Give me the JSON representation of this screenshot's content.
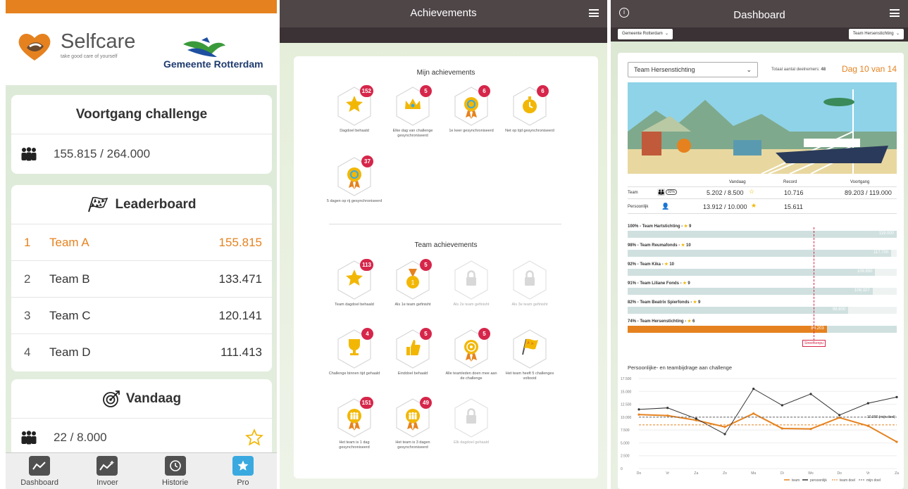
{
  "left": {
    "brand": {
      "name": "Selfcare",
      "tagline": "take good care of yourself",
      "partner": "Gemeente Rotterdam"
    },
    "progress": {
      "title": "Voortgang challenge",
      "value": "155.815 / 264.000",
      "icon": "people-icon"
    },
    "leaderboard": {
      "title": "Leaderboard",
      "icon": "checkered-flag-icon",
      "rows": [
        {
          "rank": "1",
          "team": "Team A",
          "value": "155.815"
        },
        {
          "rank": "2",
          "team": "Team B",
          "value": "133.471"
        },
        {
          "rank": "3",
          "team": "Team C",
          "value": "120.141"
        },
        {
          "rank": "4",
          "team": "Team D",
          "value": "111.413"
        }
      ]
    },
    "today": {
      "title": "Vandaag",
      "icon": "dart-target-icon",
      "value": "22 / 8.000"
    },
    "tabs": [
      {
        "label": "Dashboard",
        "icon": "chart-line-icon"
      },
      {
        "label": "Invoer",
        "icon": "chart-add-icon"
      },
      {
        "label": "Historie",
        "icon": "history-icon"
      },
      {
        "label": "Pro",
        "icon": "star-icon"
      }
    ]
  },
  "middle": {
    "title": "Achievements",
    "mine_title": "Mijn achievements",
    "mine": [
      {
        "label": "Dagdoel behaald",
        "count": "152",
        "icon": "star-icon"
      },
      {
        "label": "Elke dag van challenge gesynchroniseerd",
        "count": "5",
        "icon": "crown-icon"
      },
      {
        "label": "1e keer gesynchroniseerd",
        "count": "6",
        "icon": "sync-medal-icon"
      },
      {
        "label": "Net op tijd gesynchroniseerd",
        "count": "6",
        "icon": "stopwatch-icon"
      },
      {
        "label": "5 dagen op rij gesynchroniseerd",
        "count": "37",
        "icon": "sync-medal-icon"
      }
    ],
    "team_title": "Team achievements",
    "team": [
      {
        "label": "Team dagdoel behaald",
        "count": "113",
        "icon": "star-icon",
        "locked": false
      },
      {
        "label": "Als 1e team gefinisht",
        "count": "5",
        "icon": "medal-icon",
        "locked": false
      },
      {
        "label": "Als 2e team gefinisht",
        "count": "",
        "icon": "lock-icon",
        "locked": true
      },
      {
        "label": "Als 3e team gefinisht",
        "count": "",
        "icon": "lock-icon",
        "locked": true
      },
      {
        "label": "Challenge binnen tijd gehaald",
        "count": "4",
        "icon": "trophy-icon",
        "locked": false
      },
      {
        "label": "Einddoel behaald",
        "count": "5",
        "icon": "thumbs-up-icon",
        "locked": false
      },
      {
        "label": "Alle teamleden doen mee aan de challenge",
        "count": "5",
        "icon": "target-medal-icon",
        "locked": false
      },
      {
        "label": "Het team heeft 5 challenges voltooid",
        "count": "",
        "icon": "checkered-flag-icon",
        "locked": false
      },
      {
        "label": "Het team is 1 dag gesynchroniseerd",
        "count": "151",
        "icon": "team-medal-icon",
        "locked": false
      },
      {
        "label": "Het team is 3 dagen gesynchroniseerd",
        "count": "49",
        "icon": "team-medal-icon",
        "locked": false
      },
      {
        "label": "Elk dagdoel gehaald",
        "count": "",
        "icon": "lock-icon",
        "locked": true
      }
    ]
  },
  "right": {
    "title": "Dashboard",
    "org_select": "Gemeente Rotterdam",
    "team_select_top": "Team Hersenstichting",
    "team_select": "Team Hersenstichting",
    "participants_label": "Totaal aantal deelnemers:",
    "participants_value": "48",
    "day": "Dag 10 van 14",
    "stat_headers": {
      "today": "Vandaag",
      "record": "Record",
      "progress": "Voortgang"
    },
    "team_row": {
      "label": "Team",
      "pct": "92%",
      "today": "5.202 / 8.500",
      "record": "10.716",
      "progress": "89.203 / 119.000"
    },
    "personal_row": {
      "label": "Persoonlijk",
      "today": "13.912 / 10.000",
      "record": "15.611"
    },
    "bars": [
      {
        "label": "100% - Team Hartstichting -",
        "stars": "9",
        "fraction": 1.0,
        "value": "119.000",
        "mine": false
      },
      {
        "label": "98% - Team Reumafonds -",
        "stars": "10",
        "fraction": 0.98,
        "value": "117.700",
        "mine": false
      },
      {
        "label": "92% - Team Kika -",
        "stars": "10",
        "fraction": 0.92,
        "value": "109.950",
        "mine": false
      },
      {
        "label": "91% - Team Liliane Fonds -",
        "stars": "9",
        "fraction": 0.91,
        "value": "108.327",
        "mine": false
      },
      {
        "label": "82% - Team Beatrix Spierfonds -",
        "stars": "9",
        "fraction": 0.82,
        "value": "98.600",
        "mine": false
      },
      {
        "label": "74% - Team Hersenstichting -",
        "stars": "6",
        "fraction": 0.74,
        "value": "89.203",
        "mine": true
      }
    ],
    "target_label": "Streefkenpu",
    "chart_data": {
      "type": "line",
      "title": "Persoonlijke- en teambijdrage aan challenge",
      "categories": [
        "Do",
        "Vr",
        "Za",
        "Zo",
        "Ma",
        "Di",
        "Wo",
        "Do",
        "Vr",
        "Za"
      ],
      "ylim": [
        0,
        17500
      ],
      "yticks": [
        "17.500",
        "15.000",
        "12.500",
        "10.000",
        "7.500",
        "5.000",
        "2.500",
        "0"
      ],
      "series": [
        {
          "name": "team",
          "color": "#e5821f",
          "values": [
            10500,
            10300,
            9400,
            8100,
            10700,
            7800,
            7700,
            9900,
            8300,
            5200
          ]
        },
        {
          "name": "persoonlijk",
          "color": "#333333",
          "values": [
            11500,
            11800,
            9700,
            6700,
            15500,
            12300,
            14500,
            10400,
            12700,
            13900
          ]
        },
        {
          "name": "team doel",
          "color": "#e5821f",
          "dash": true,
          "values": [
            8500,
            8500,
            8500,
            8500,
            8500,
            8500,
            8500,
            8500,
            8500,
            8500
          ]
        },
        {
          "name": "mijn doel",
          "color": "#666666",
          "dash": true,
          "values": [
            10000,
            10000,
            10000,
            10000,
            10000,
            10000,
            10000,
            10000,
            10000,
            10000
          ]
        }
      ],
      "annotation": "10.000 (mijn doel)"
    }
  }
}
